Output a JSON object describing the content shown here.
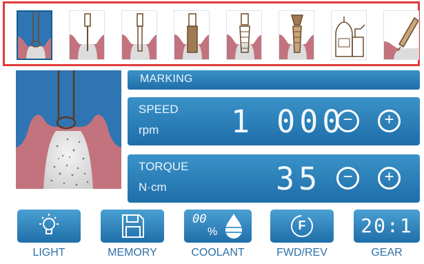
{
  "steps": [
    {
      "icon": "drill-active-icon"
    },
    {
      "icon": "pilot-drill-icon"
    },
    {
      "icon": "twist-drill-icon"
    },
    {
      "icon": "wide-drill-icon"
    },
    {
      "icon": "tap-icon"
    },
    {
      "icon": "implant-placement-icon"
    },
    {
      "icon": "cleaning-bottles-icon"
    },
    {
      "icon": "irrigation-nozzle-icon"
    }
  ],
  "marking": {
    "label": "MARKING"
  },
  "speed": {
    "label": "SPEED",
    "unit": "rpm",
    "value": "1 000",
    "minus": "−",
    "plus": "+"
  },
  "torque": {
    "label": "TORQUE",
    "unit": "N·cm",
    "value": "35",
    "minus": "−",
    "plus": "+"
  },
  "buttons": {
    "light": {
      "label": "LIGHT",
      "icon": "light-bulb-icon"
    },
    "memory": {
      "label": "MEMORY",
      "icon": "floppy-disk-icon"
    },
    "coolant": {
      "label": "COOLANT",
      "icon": "water-drop-icon",
      "display": "00",
      "unit": "%"
    },
    "fwdrev": {
      "label": "FWD/REV",
      "icon": "forward-icon",
      "display": "F"
    },
    "gear": {
      "label": "GEAR",
      "display": "20:1"
    }
  },
  "colors": {
    "accent": "#1f6ea9",
    "highlight": "#e23a3a",
    "gum": "#c2737e",
    "bone": "#d4d4d4"
  }
}
